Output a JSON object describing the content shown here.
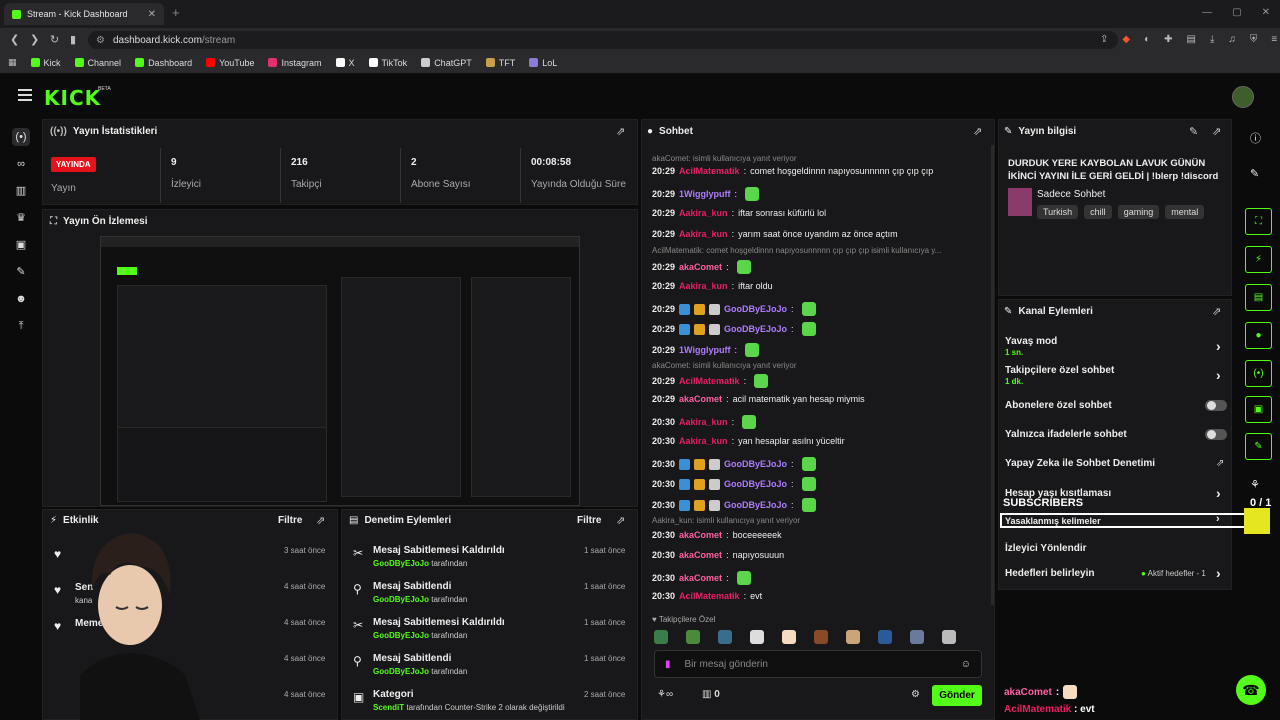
{
  "browser": {
    "tab_title": "Stream - Kick Dashboard",
    "url_host": "dashboard.kick.com",
    "url_path": "/stream",
    "bookmarks": [
      {
        "label": "Kick",
        "color": "#53fc18"
      },
      {
        "label": "Channel",
        "color": "#53fc18"
      },
      {
        "label": "Dashboard",
        "color": "#53fc18"
      },
      {
        "label": "YouTube",
        "color": "#ff0000"
      },
      {
        "label": "Instagram",
        "color": "#e1306c"
      },
      {
        "label": "X",
        "color": "#ffffff"
      },
      {
        "label": "TikTok",
        "color": "#ffffff"
      },
      {
        "label": "ChatGPT",
        "color": "#cccccc"
      },
      {
        "label": "TFT",
        "color": "#c8a04a"
      },
      {
        "label": "LoL",
        "color": "#8a7cd8"
      }
    ]
  },
  "app": {
    "logo": "KICK",
    "beta": "BETA",
    "accent": "#53fc18"
  },
  "stats": {
    "title": "Yayın İstatistikleri",
    "live_badge": "YAYINDA",
    "items": [
      {
        "value": "",
        "label": "Yayın"
      },
      {
        "value": "9",
        "label": "İzleyici"
      },
      {
        "value": "216",
        "label": "Takipçi"
      },
      {
        "value": "2",
        "label": "Abone Sayısı"
      },
      {
        "value": "00:08:58",
        "label": "Yayında Olduğu Süre"
      }
    ]
  },
  "preview": {
    "title": "Yayın Ön İzlemesi"
  },
  "events": {
    "title": "Etkinlik",
    "filter": "Filtre",
    "rows": [
      {
        "name": "",
        "sub": "",
        "time": "3 saat önce"
      },
      {
        "name": "Sen",
        "sub": "kana",
        "time": "4 saat önce"
      },
      {
        "name": "Meme",
        "sub": "",
        "time": "4 saat önce"
      },
      {
        "name": "",
        "sub": "",
        "time": "4 saat önce"
      },
      {
        "name": "",
        "sub": "",
        "time": "4 saat önce"
      }
    ]
  },
  "moderation": {
    "title": "Denetim Eylemleri",
    "filter": "Filtre",
    "rows": [
      {
        "title": "Mesaj Sabitlemesi Kaldırıldı",
        "user": "GooDByEJoJo",
        "suffix": "tarafından",
        "time": "1 saat önce"
      },
      {
        "title": "Mesaj Sabitlendi",
        "user": "GooDByEJoJo",
        "suffix": "tarafından",
        "time": "1 saat önce"
      },
      {
        "title": "Mesaj Sabitlemesi Kaldırıldı",
        "user": "GooDByEJoJo",
        "suffix": "tarafından",
        "time": "1 saat önce"
      },
      {
        "title": "Mesaj Sabitlendi",
        "user": "GooDByEJoJo",
        "suffix": "tarafından",
        "time": "1 saat önce"
      },
      {
        "title": "Kategori",
        "user": "ScendiT",
        "suffix": "tarafından Counter-Strike 2 olarak değiştirildi",
        "time": "2 saat önce"
      }
    ]
  },
  "chat": {
    "title": "Sohbet",
    "lines": [
      {
        "type": "reply",
        "text": "akaComet: isimli kullanıcıya yanıt veriyor"
      },
      {
        "type": "msg",
        "time": "20:29",
        "user": "AcilMatematik",
        "color": "red",
        "text": "comet hoşgeldinnn napıyosunnnnn çıp çıp çıp"
      },
      {
        "type": "msg",
        "time": "20:29",
        "user": "1Wigglypuff",
        "color": "pur",
        "text": ""
      },
      {
        "type": "msg",
        "time": "20:29",
        "user": "Aakira_kun",
        "color": "red",
        "text": "iftar sonrası küfürlü lol"
      },
      {
        "type": "msg",
        "time": "20:29",
        "user": "Aakira_kun",
        "color": "red",
        "text": "yarım saat önce uyandım az önce açtım"
      },
      {
        "type": "reply",
        "text": "AcilMatematik: comet hoşgeldinnn napıyosunnnnn çıp çıp çıp isimli kullanıcıya y..."
      },
      {
        "type": "msg",
        "time": "20:29",
        "user": "akaComet",
        "color": "pink",
        "text": ""
      },
      {
        "type": "msg",
        "time": "20:29",
        "user": "Aakira_kun",
        "color": "red",
        "text": "iftar oldu"
      },
      {
        "type": "msg",
        "time": "20:29",
        "user": "GooDByEJoJo",
        "color": "pur",
        "text": ""
      },
      {
        "type": "msg",
        "time": "20:29",
        "user": "GooDByEJoJo",
        "color": "pur",
        "text": ""
      },
      {
        "type": "msg",
        "time": "20:29",
        "user": "1Wigglypuff",
        "color": "pur",
        "text": ""
      },
      {
        "type": "reply",
        "text": "akaComet: isimli kullanıcıya yanıt veriyor"
      },
      {
        "type": "msg",
        "time": "20:29",
        "user": "AcilMatematik",
        "color": "red",
        "text": ""
      },
      {
        "type": "msg",
        "time": "20:29",
        "user": "akaComet",
        "color": "pink",
        "text": "acil matematik yan hesap miymis"
      },
      {
        "type": "msg",
        "time": "20:30",
        "user": "Aakira_kun",
        "color": "red",
        "text": ""
      },
      {
        "type": "msg",
        "time": "20:30",
        "user": "Aakira_kun",
        "color": "red",
        "text": "yan hesaplar asılnı yüceltir"
      },
      {
        "type": "msg",
        "time": "20:30",
        "user": "GooDByEJoJo",
        "color": "pur",
        "text": ""
      },
      {
        "type": "msg",
        "time": "20:30",
        "user": "GooDByEJoJo",
        "color": "pur",
        "text": ""
      },
      {
        "type": "msg",
        "time": "20:30",
        "user": "GooDByEJoJo",
        "color": "pur",
        "text": ""
      },
      {
        "type": "reply",
        "text": "Aakira_kun: isimli kullanıcıya yanıt veriyor"
      },
      {
        "type": "msg",
        "time": "20:30",
        "user": "akaComet",
        "color": "pink",
        "text": "boceeeeeek"
      },
      {
        "type": "msg",
        "time": "20:30",
        "user": "akaComet",
        "color": "pink",
        "text": "napıyosuuun"
      },
      {
        "type": "msg",
        "time": "20:30",
        "user": "akaComet",
        "color": "pink",
        "text": ""
      },
      {
        "type": "msg",
        "time": "20:30",
        "user": "AcilMatematik",
        "color": "red",
        "text": "evt"
      }
    ],
    "followers_label": "Takipçilere Özel",
    "input_placeholder": "Bir mesaj gönderin",
    "points": "0",
    "send": "Gönder"
  },
  "info": {
    "title": "Yayın bilgisi",
    "stream_title": "DURDUK YERE KAYBOLAN LAVUK GÜNÜN İKİNCİ YAYINI İLE GERİ GELDİ | !blerp !discord",
    "category": "Sadece Sohbet",
    "tags": [
      "Turkish",
      "chill",
      "gaming",
      "mental"
    ]
  },
  "actions": {
    "title": "Kanal Eylemleri",
    "items": [
      {
        "label": "Yavaş mod",
        "sub": "1 sn.",
        "kind": "chevron"
      },
      {
        "label": "Takipçilere özel sohbet",
        "sub": "1 dk.",
        "kind": "chevron"
      },
      {
        "label": "Abonelere özel sohbet",
        "sub": "",
        "kind": "toggle"
      },
      {
        "label": "Yalnızca ifadelerle sohbet",
        "sub": "",
        "kind": "toggle"
      },
      {
        "label": "Yapay Zeka ile Sohbet Denetimi",
        "sub": "",
        "kind": "popout"
      },
      {
        "label": "Hesap yaşı kısıtlaması",
        "sub": "",
        "kind": "chevron"
      },
      {
        "label": "Yasaklanmış kelimeler",
        "sub": "",
        "kind": "chevron"
      },
      {
        "label": "İzleyici Yönlendir",
        "sub": "",
        "kind": "none"
      },
      {
        "label": "Hedefleri belirleyin",
        "sub": "",
        "kind": "chevron"
      }
    ],
    "goal_status": "Aktif hedefler - 1"
  },
  "overlay": {
    "subscribers": "SUBSCRIBERS",
    "count": "0 / 1",
    "chat1_user": "akaComet",
    "chat2_user": "AcilMatematik",
    "chat2_text": "evt"
  }
}
